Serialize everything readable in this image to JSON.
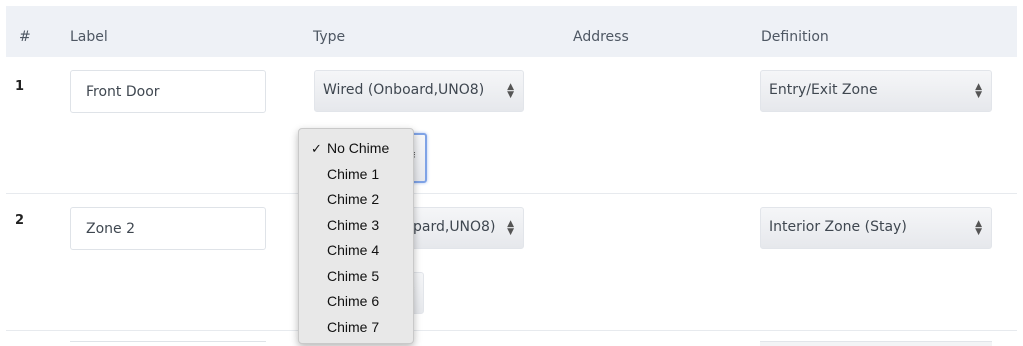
{
  "table": {
    "headers": {
      "num": "#",
      "label": "Label",
      "type": "Type",
      "address": "Address",
      "definition": "Definition"
    }
  },
  "rows": [
    {
      "number": "1",
      "label": "Front Door",
      "type": "Wired (Onboard,UNO8)",
      "definition": "Entry/Exit Zone"
    },
    {
      "number": "2",
      "label": "Zone 2",
      "type": "pard,UNO8)",
      "definition": "Interior Zone (Stay)"
    }
  ],
  "chime_dropdown": {
    "selected": "No Chime",
    "check_glyph": "✓",
    "options": [
      "No Chime",
      "Chime 1",
      "Chime 2",
      "Chime 3",
      "Chime 4",
      "Chime 5",
      "Chime 6",
      "Chime 7"
    ]
  }
}
